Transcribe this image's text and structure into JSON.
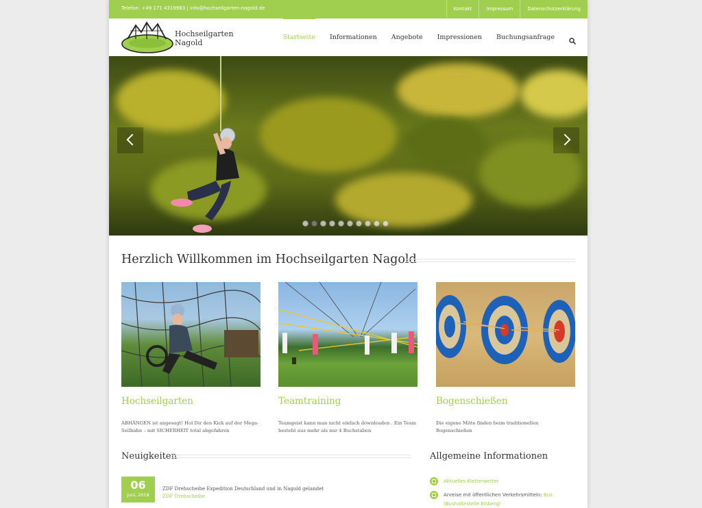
{
  "topbar": {
    "contact": "Telefon: +49 171 4319983 | info@hochseilgarten-nagold.de",
    "links": [
      "Kontakt",
      "Impressum",
      "Datenschutzerklärung"
    ]
  },
  "brand": {
    "line1": "Hochseilgarten",
    "line2": "Nagold"
  },
  "nav": {
    "items": [
      "Startseite",
      "Informationen",
      "Angebote",
      "Impressionen",
      "Buchungsanfrage"
    ],
    "active_index": 0
  },
  "slider": {
    "total_slides": 10,
    "active_slide": 2
  },
  "welcome_title": "Herzlich Willkommen im Hochseilgarten Nagold",
  "cards": [
    {
      "title": "Hochseilgarten",
      "text": "ABHÄNGEN ist angesagt! Hol Dir den Kick auf der Mega-Seilbahn – mit SICHERHEIT total abgefahren"
    },
    {
      "title": "Teamtraining",
      "text": "Teamgeist kann man nicht einfach downloaden . Ein Team besteht aus mehr als nur 4 Buchstaben"
    },
    {
      "title": "Bogenschießen",
      "text": "Die eigene Mitte finden beim traditionellen Bogenschießen"
    }
  ],
  "news": {
    "heading": "Neuigkeiten",
    "items": [
      {
        "day": "06",
        "month": "Juni, 2018",
        "title": "ZDF Drehscheibe Expedition Deutschland und in Nagold gelandet",
        "category": "ZDF Drehscheibe"
      }
    ]
  },
  "info": {
    "heading": "Allgemeine Informationen",
    "items": [
      {
        "link": "Aktuelles Kletterwetter"
      },
      {
        "text": "Anreise mit öffentlichen Verkehrsmitteln: ",
        "link": "Bus",
        "link2": "(Bushaltestelle Eisberg)"
      }
    ]
  },
  "colors": {
    "accent": "#a0ce4e",
    "background": "#ececec"
  }
}
